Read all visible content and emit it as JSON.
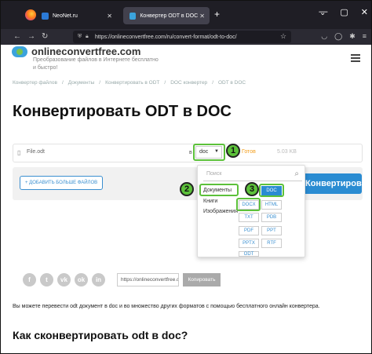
{
  "browser": {
    "tabs": [
      {
        "title": "NeoNet.ru",
        "fav_color": "#2b7ad6"
      },
      {
        "title": "Конвертер ODT в DOC онлайн",
        "fav_color": "#3ba3dc"
      }
    ],
    "url": "https://onlineconvertfree.com/ru/convert-format/odt-to-doc/"
  },
  "site": {
    "logo": "onlineconvertfree.com",
    "tagline": "Преобразование файлов в Интернете бесплатно и быстро!",
    "breadcrumbs": [
      "Конвертер файлов",
      "/",
      "Документы",
      "/",
      "Конвертировать в ODT",
      "/",
      "DOC конвертер",
      "/",
      "ODT в DOC"
    ],
    "title": "Конвертировать ODT в DOC"
  },
  "file": {
    "name": "File.odt",
    "to_label": "в",
    "format": "doc",
    "status": "Готов",
    "size": "5.03 KB"
  },
  "actions": {
    "add_more": "+ ДОБАВИТЬ БОЛЬШЕ ФАЙЛОВ",
    "convert": "Конвертировать"
  },
  "dropdown": {
    "search_placeholder": "Поиск",
    "categories": [
      "Документы",
      "Книги",
      "Изображения"
    ],
    "formats": [
      "DOC",
      "DOCX",
      "HTML",
      "TXT",
      "PDB",
      "PDF",
      "PPT",
      "PPTX",
      "RTF",
      "ODT"
    ]
  },
  "annotations": [
    "1",
    "2",
    "3"
  ],
  "share": {
    "url": "https://onlineconvertfree.com/ru/convert-format/odt-to-doc/",
    "copy": "Копировать",
    "networks": [
      "f",
      "t",
      "vk",
      "ok",
      "in"
    ]
  },
  "content": {
    "description": "Вы можете перевести odt документ в doc и во множество других форматов с помощью бесплатного онлайн конвертера.",
    "subheading": "Как сконвертировать odt в doc?"
  },
  "colors": {
    "accent": "#2a8cd2",
    "highlight": "#5cc13a"
  }
}
